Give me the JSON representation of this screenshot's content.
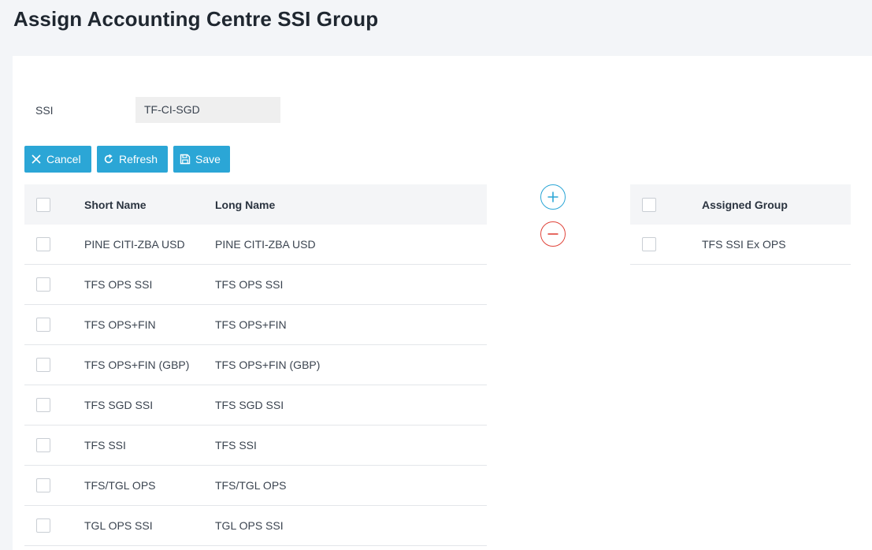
{
  "page": {
    "title": "Assign Accounting Centre SSI Group"
  },
  "form": {
    "ssi_label": "SSI",
    "ssi_value": "TF-CI-SGD"
  },
  "toolbar": {
    "cancel_label": "Cancel",
    "refresh_label": "Refresh",
    "save_label": "Save"
  },
  "available": {
    "headers": {
      "short": "Short Name",
      "long": "Long Name"
    },
    "rows": [
      {
        "short": "PINE CITI-ZBA USD",
        "long": "PINE CITI-ZBA USD"
      },
      {
        "short": "TFS OPS SSI",
        "long": "TFS OPS SSI"
      },
      {
        "short": "TFS OPS+FIN",
        "long": "TFS OPS+FIN"
      },
      {
        "short": "TFS OPS+FIN (GBP)",
        "long": "TFS OPS+FIN (GBP)"
      },
      {
        "short": "TFS SGD SSI",
        "long": "TFS SGD SSI"
      },
      {
        "short": "TFS SSI",
        "long": "TFS SSI"
      },
      {
        "short": "TFS/TGL OPS",
        "long": "TFS/TGL OPS"
      },
      {
        "short": "TGL OPS SSI",
        "long": "TGL OPS SSI"
      }
    ]
  },
  "assigned": {
    "header": "Assigned Group",
    "rows": [
      {
        "name": "TFS SSI Ex OPS"
      }
    ]
  },
  "icons": {
    "add": "plus-circle-icon",
    "remove": "minus-circle-icon"
  },
  "colors": {
    "primary": "#2ba6d6",
    "danger": "#e0443a"
  }
}
